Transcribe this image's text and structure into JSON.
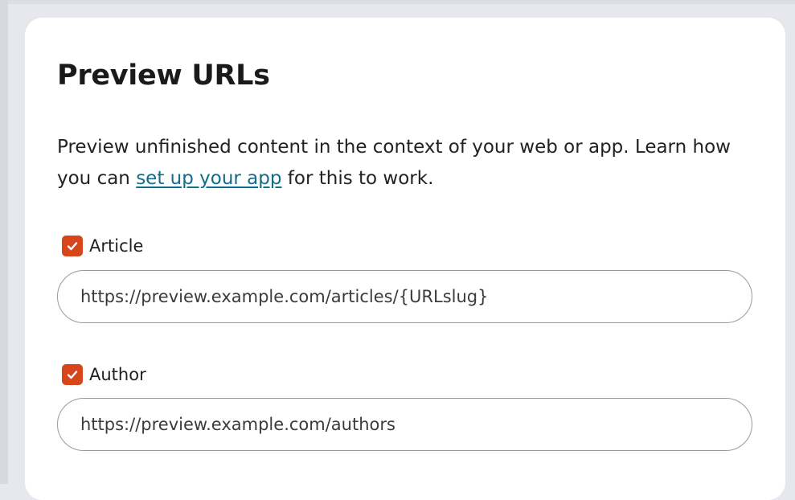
{
  "panel": {
    "title": "Preview URLs",
    "description_before": "Preview unfinished content in the context of your web or app. Learn how you can ",
    "description_link": "set up your app",
    "description_after": " for this to work."
  },
  "content_types": [
    {
      "label": "Article",
      "checked": true,
      "url": "https://preview.example.com/articles/{URLslug}"
    },
    {
      "label": "Author",
      "checked": true,
      "url": "https://preview.example.com/authors"
    }
  ],
  "colors": {
    "checkbox_accent": "#d6451c",
    "link": "#136c8a"
  },
  "icons": {
    "checkbox": "check-icon"
  }
}
